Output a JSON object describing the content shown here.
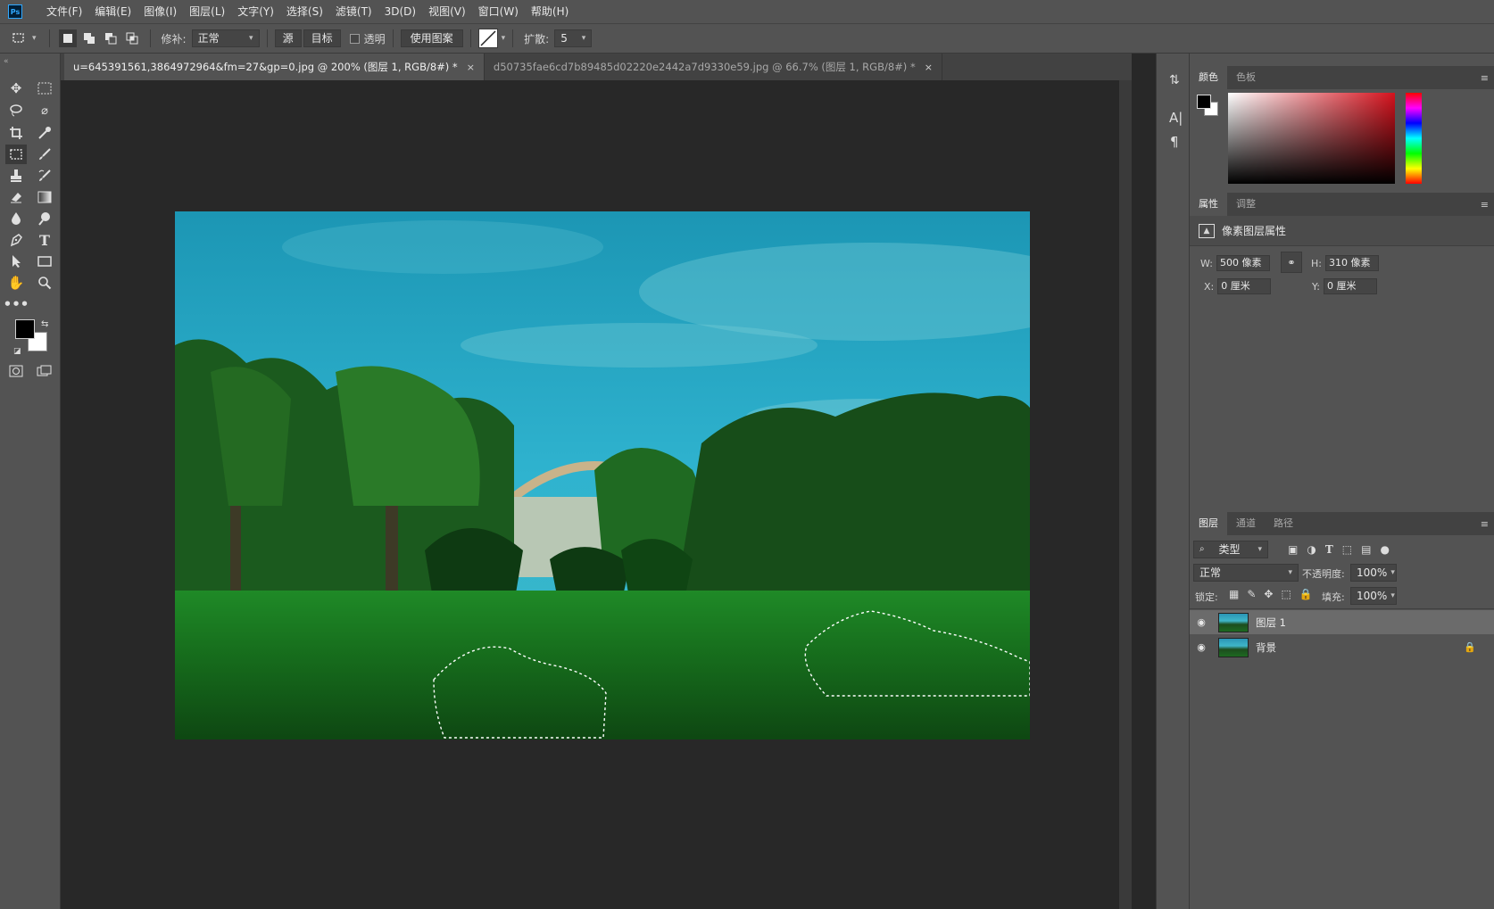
{
  "menu": [
    "文件(F)",
    "编辑(E)",
    "图像(I)",
    "图层(L)",
    "文字(Y)",
    "选择(S)",
    "滤镜(T)",
    "3D(D)",
    "视图(V)",
    "窗口(W)",
    "帮助(H)"
  ],
  "app_logo": "Ps",
  "options": {
    "patch_label": "修补:",
    "patch_mode": "正常",
    "source_btn": "源",
    "target_btn": "目标",
    "transparent_label": "透明",
    "use_pattern_btn": "使用图案",
    "diffusion_label": "扩散:",
    "diffusion_value": "5"
  },
  "tabs": [
    {
      "label": "u=645391561,3864972964&fm=27&gp=0.jpg @ 200% (图层 1, RGB/8#) *",
      "active": true
    },
    {
      "label": "d50735fae6cd7b89485d02220e2442a7d9330e59.jpg @ 66.7% (图层 1, RGB/8#) *",
      "active": false
    }
  ],
  "tab_close_glyph": "×",
  "color_panel": {
    "tabs": [
      "颜色",
      "色板"
    ],
    "foreground": "#000000",
    "background": "#ffffff",
    "hue": "#d5121d"
  },
  "properties_panel": {
    "tabs": [
      "属性",
      "调整"
    ],
    "title": "像素图层属性",
    "w_label": "W:",
    "w_value": "500 像素",
    "h_label": "H:",
    "h_value": "310 像素",
    "x_label": "X:",
    "x_value": "0 厘米",
    "y_label": "Y:",
    "y_value": "0 厘米"
  },
  "layers_panel": {
    "tabs": [
      "图层",
      "通道",
      "路径"
    ],
    "filter_kind": "类型",
    "blend_mode": "正常",
    "opacity_label": "不透明度:",
    "opacity_value": "100%",
    "lock_label": "锁定:",
    "fill_label": "填充:",
    "fill_value": "100%",
    "layers": [
      {
        "name": "图层 1",
        "selected": true,
        "locked": false
      },
      {
        "name": "背景",
        "selected": false,
        "locked": true
      }
    ]
  },
  "icons": {
    "menu": "≡",
    "eye": "👁",
    "lock": "🔒",
    "chevron": "⌄"
  }
}
